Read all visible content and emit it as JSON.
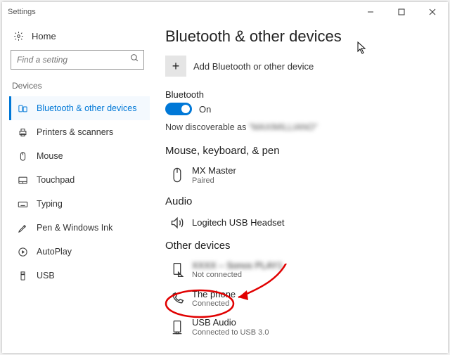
{
  "window": {
    "title": "Settings"
  },
  "sidebar": {
    "home": "Home",
    "search_placeholder": "Find a setting",
    "category": "Devices",
    "items": [
      {
        "label": "Bluetooth & other devices"
      },
      {
        "label": "Printers & scanners"
      },
      {
        "label": "Mouse"
      },
      {
        "label": "Touchpad"
      },
      {
        "label": "Typing"
      },
      {
        "label": "Pen & Windows Ink"
      },
      {
        "label": "AutoPlay"
      },
      {
        "label": "USB"
      }
    ]
  },
  "main": {
    "title": "Bluetooth & other devices",
    "add_label": "Add Bluetooth or other device",
    "bt_header": "Bluetooth",
    "bt_state": "On",
    "discover_prefix": "Now discoverable as ",
    "discover_name": "\"MAXIMILLIANO\"",
    "sections": {
      "mouse": {
        "header": "Mouse, keyboard, & pen",
        "devices": [
          {
            "name": "MX Master",
            "status": "Paired"
          }
        ]
      },
      "audio": {
        "header": "Audio",
        "devices": [
          {
            "name": "Logitech USB Headset",
            "status": ""
          }
        ]
      },
      "other": {
        "header": "Other devices",
        "devices": [
          {
            "name": "XXXX – Sonos PLAY1",
            "status": "Not connected"
          },
          {
            "name": "The phone",
            "status": "Connected"
          },
          {
            "name": "USB Audio",
            "status": "Connected to USB 3.0"
          }
        ]
      }
    }
  }
}
